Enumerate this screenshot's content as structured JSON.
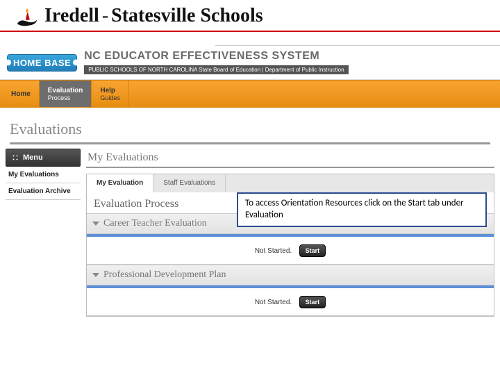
{
  "school_header": {
    "name_part1": "Iredell",
    "dash": "-",
    "name_part2": "Statesville Schools"
  },
  "system": {
    "logo_text": "HOME BASE",
    "name": "NC EDUCATOR EFFECTIVENESS SYSTEM",
    "sub": "PUBLIC SCHOOLS OF NORTH CAROLINA  State Board of Education | Department of Public Instruction"
  },
  "tabs": [
    {
      "main": "Home",
      "sub": ""
    },
    {
      "main": "Evaluation",
      "sub": "Process"
    },
    {
      "main": "Help",
      "sub": "Guides"
    }
  ],
  "page_title": "Evaluations",
  "sidebar": {
    "menu_label": "Menu",
    "items": [
      "My Evaluations",
      "Evaluation Archive"
    ]
  },
  "main": {
    "section_title": "My Evaluations",
    "inner_tabs": [
      "My Evaluation",
      "Staff Evaluations"
    ],
    "process_title": "Evaluation Process",
    "callout": "To access Orientation Resources click on the Start tab under Evaluation",
    "items": [
      {
        "title": "Career Teacher Evaluation",
        "status": "Not Started.",
        "button": "Start"
      },
      {
        "title": "Professional Development Plan",
        "status": "Not Started.",
        "button": "Start"
      }
    ]
  }
}
